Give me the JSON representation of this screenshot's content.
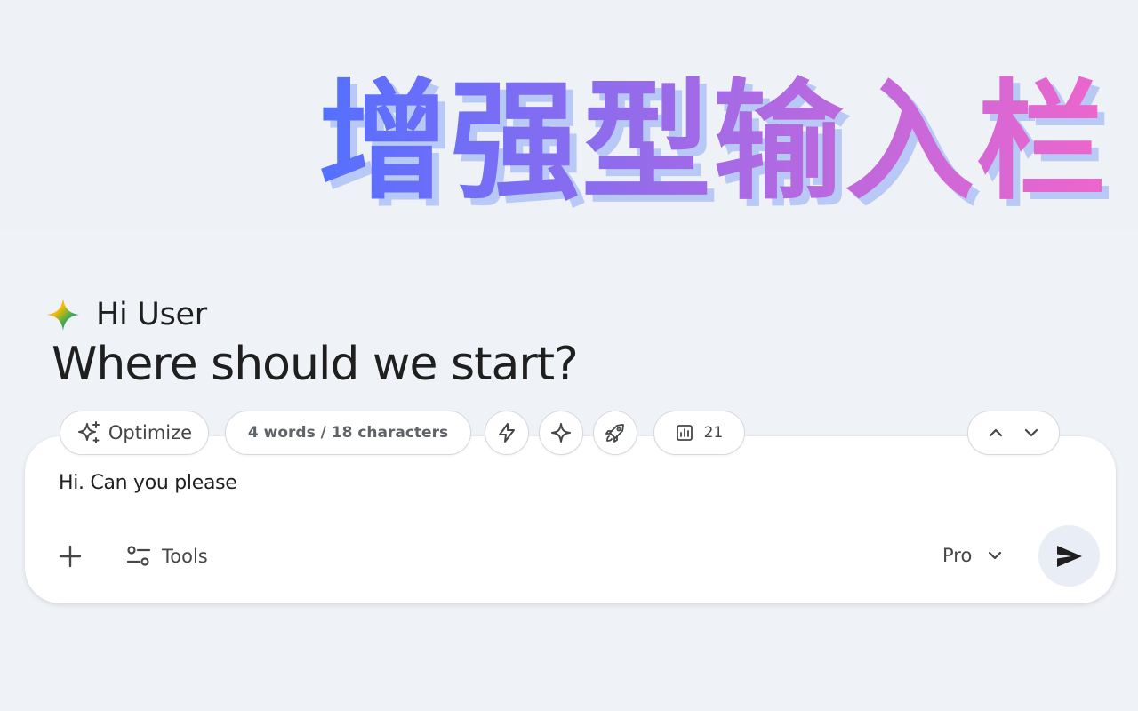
{
  "banner": {
    "title": "增强型输入栏",
    "gradient_start": "#5470ff",
    "gradient_end": "#ee66cc",
    "shadow_color": "#b9c9f5"
  },
  "greeting": {
    "icon": "gemini-spark-icon",
    "text": "Hi User"
  },
  "headline": "Where should we start?",
  "enhancer_bar": {
    "optimize_label": "Optimize",
    "optimize_icon": "sparkles-icon",
    "count_label": "4 words / 18 characters",
    "bolt_icon": "lightning-icon",
    "spark_icon": "spark-icon",
    "rocket_icon": "rocket-icon",
    "stat_icon": "bar-chart-icon",
    "stat_value": "21",
    "up_icon": "chevron-up-icon",
    "down_icon": "chevron-down-icon"
  },
  "composer": {
    "text": "Hi. Can you please",
    "add_icon": "plus-icon",
    "tools_icon": "tune-icon",
    "tools_label": "Tools",
    "model_label": "Pro",
    "model_icon": "chevron-down-icon",
    "send_icon": "send-icon",
    "send_bg": "#e9eef6"
  }
}
